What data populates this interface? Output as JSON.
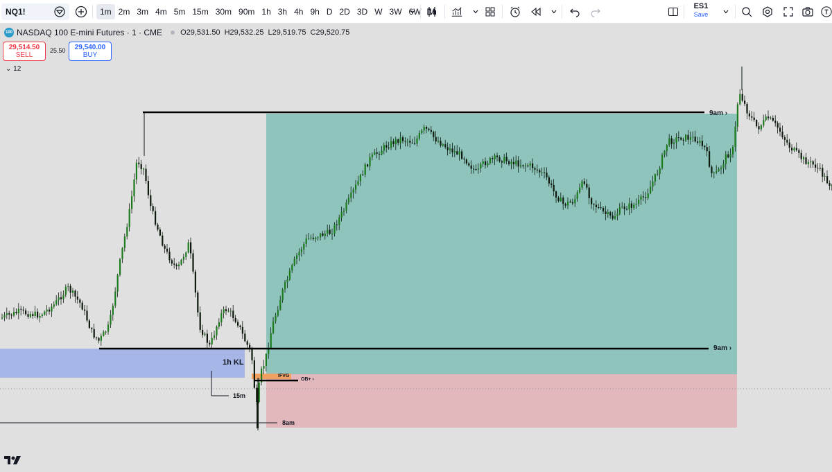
{
  "toolbar": {
    "symbol": "NQ1!",
    "intervals": [
      "1m",
      "2m",
      "3m",
      "4m",
      "5m",
      "15m",
      "30m",
      "90m",
      "1h",
      "3h",
      "4h",
      "9h",
      "D",
      "2D",
      "3D",
      "W",
      "3W",
      "6W",
      "M"
    ],
    "active_interval": "1m",
    "layout_name": "ES1",
    "save_label": "Save"
  },
  "legend": {
    "logo_text": "100",
    "title": "NASDAQ 100 E-mini Futures · 1 · CME",
    "open": "O29,531.50",
    "high": "H29,532.25",
    "low": "L29,519.75",
    "close": "C29,520.75"
  },
  "trade": {
    "sell_price": "29,514.50",
    "sell_label": "SELL",
    "spread": "25.50",
    "buy_price": "29,540.00",
    "buy_label": "BUY"
  },
  "indicators_toggle": "⌄ 12",
  "annotations": {
    "top_level": "9am",
    "mid_level": "9am",
    "key_level": "1h KL",
    "ifvg": "IFVG",
    "ob": "OB+",
    "m15": "15m",
    "low_level": "8am"
  },
  "colors": {
    "bull": "#1b7a1b",
    "bear": "#0d1a0d",
    "profit_zone": "#8fc4bc",
    "loss_zone": "#e3b8bd",
    "key_level_zone": "#a6b6e6",
    "ifvg": "#f0a060"
  }
}
